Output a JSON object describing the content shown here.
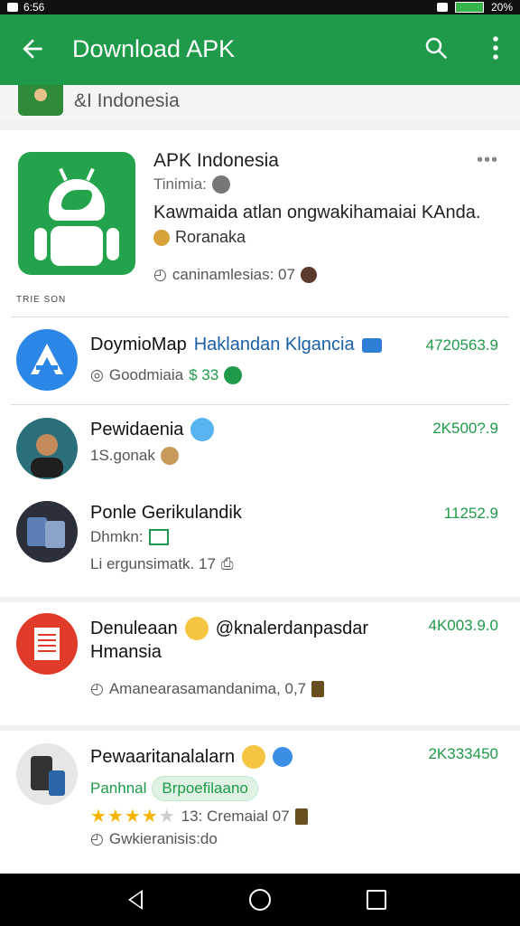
{
  "status": {
    "left": "6:56",
    "right": "20%"
  },
  "appbar": {
    "title": "Download APK"
  },
  "crumb": {
    "text": "&I Indonesia"
  },
  "hero": {
    "title": "APK Indonesia",
    "sub": "Tinimia:",
    "desc": "Kawmaida atlan ongwakihamaiai KAnda.",
    "dev": "Roranaka",
    "meta": "caninamlesias: 07",
    "cap": "TRIE SON",
    "dots": "•••"
  },
  "rows": [
    {
      "title_a": "DoymioMap",
      "title_b": "Haklandan Klgancia",
      "sub_a": "Goodmiaia",
      "sub_b": "$ 33",
      "num": "4720563.9"
    },
    {
      "title": "Pewidaenia",
      "sub": "1S.gonak",
      "num": "2K500?.9"
    },
    {
      "title": "Ponle Gerikulandik",
      "sub": "Dhmkn:",
      "sub2": "Li ergunsimatk. 17",
      "num": "11252.9"
    },
    {
      "title_a": "Denuleaan",
      "title_b": "@knalerdanpasdar",
      "title_c": "Hmansia",
      "sub": "Amanearasamandanima, 0,7",
      "num": "4K003.9.0"
    },
    {
      "title": "Pewaaritanalalarn",
      "sub_a": "Panhnal",
      "pill": "Brpoefilaano",
      "sub_b": "13: Cremaial 07",
      "sub_c": "Gwkieranisis:do",
      "num": "2K333450"
    }
  ]
}
